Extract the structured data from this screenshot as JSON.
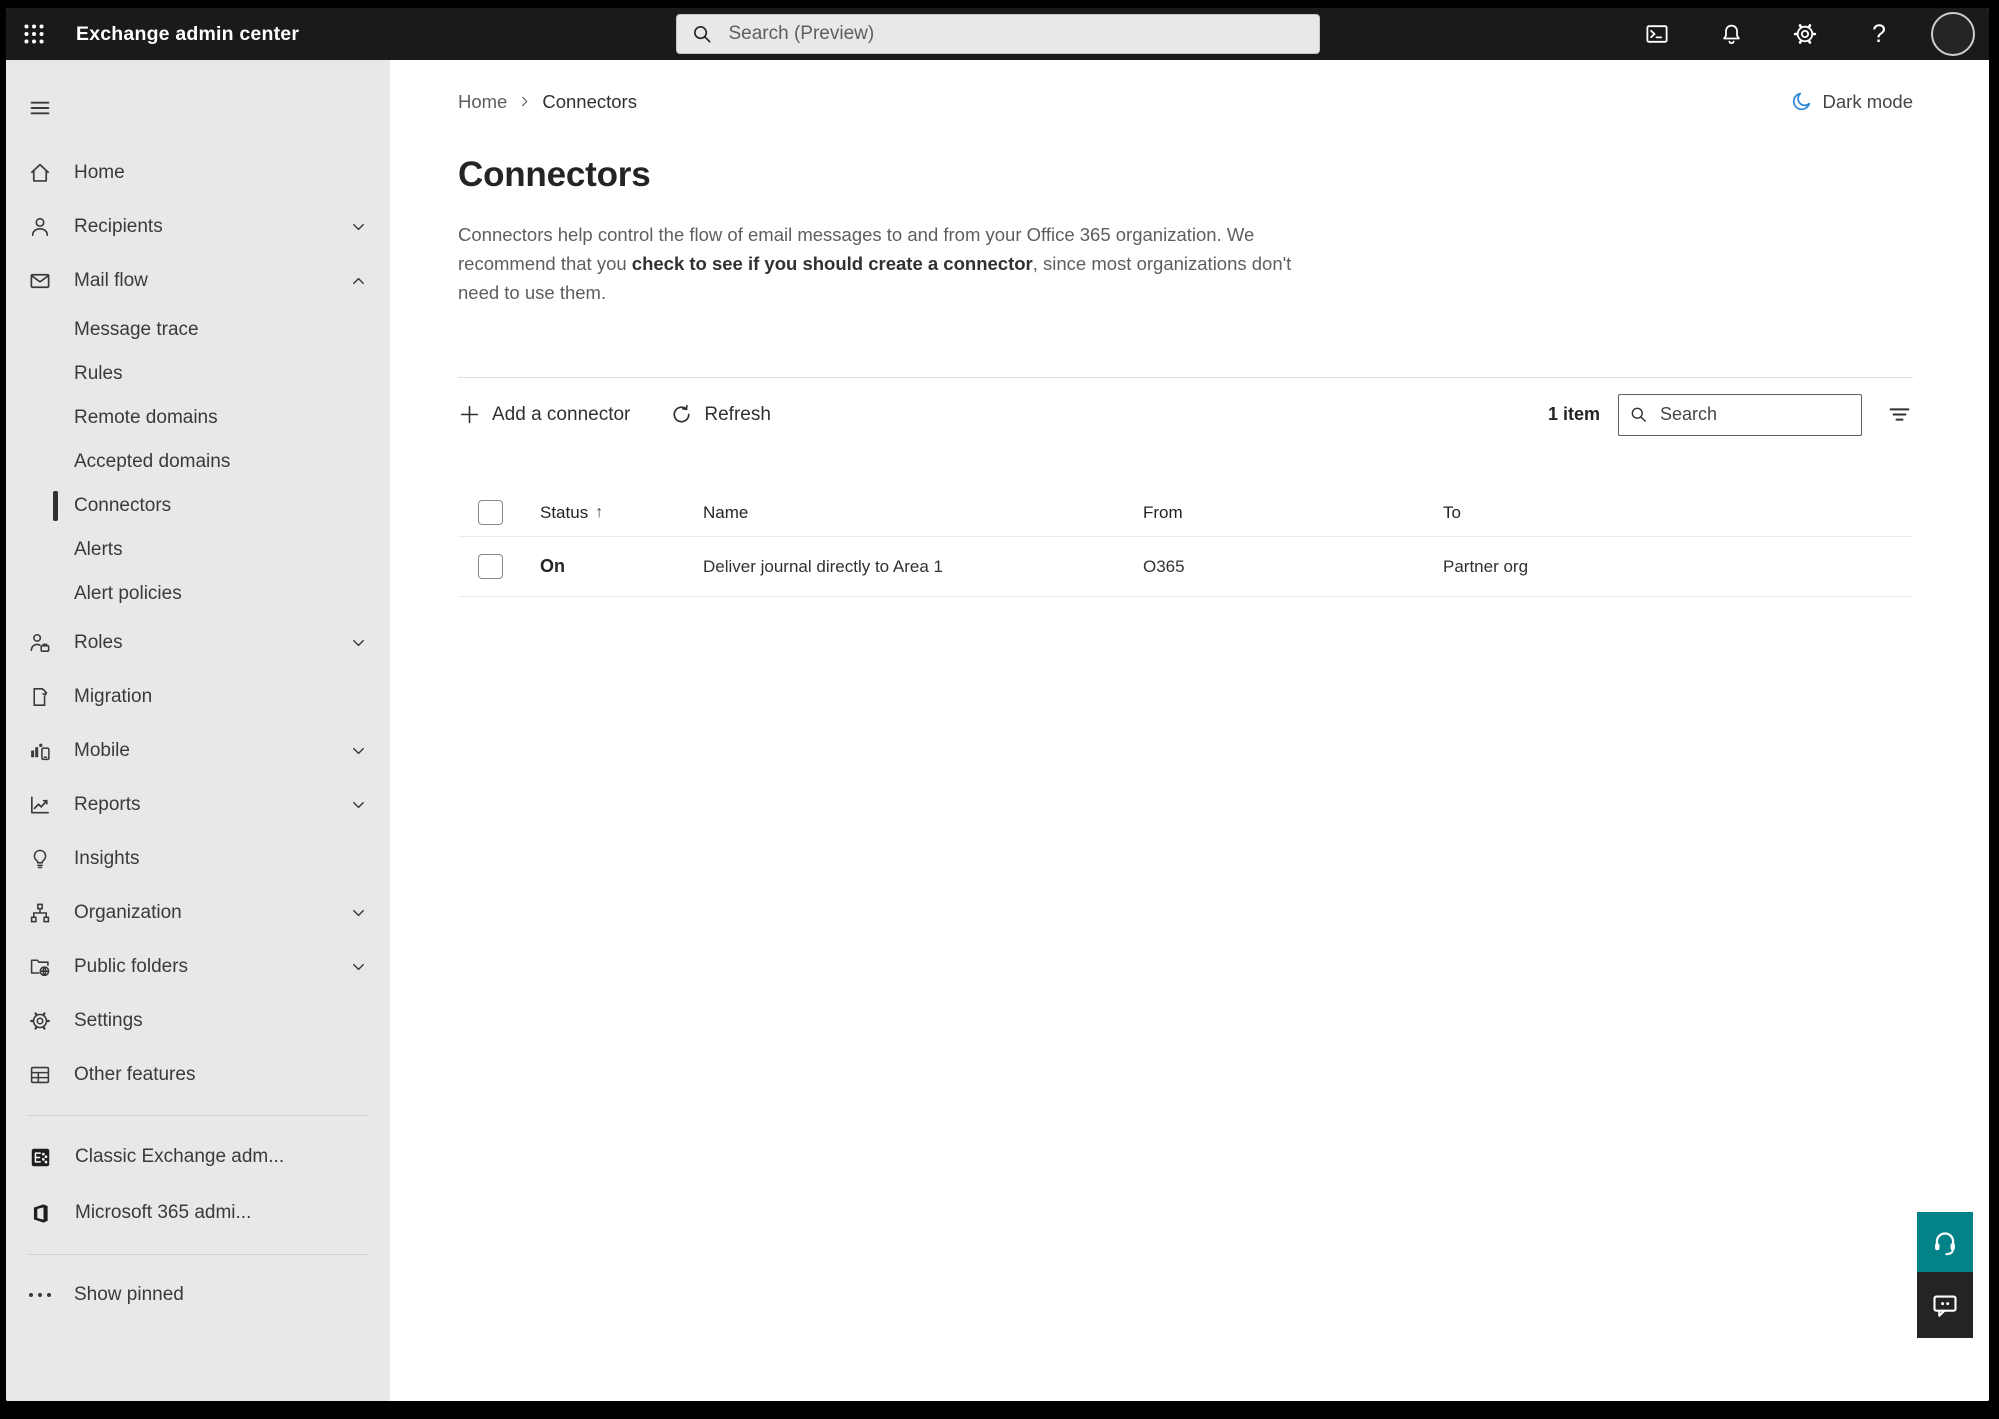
{
  "topbar": {
    "app_title": "Exchange admin center",
    "search_placeholder": "Search (Preview)",
    "icons": [
      "app-launcher",
      "powershell-terminal",
      "notifications-bell",
      "settings-gear",
      "help",
      "account-avatar"
    ]
  },
  "sidebar": {
    "items": [
      {
        "label": "Home",
        "icon": "home"
      },
      {
        "label": "Recipients",
        "icon": "person",
        "chevron": "down"
      },
      {
        "label": "Mail flow",
        "icon": "mail",
        "chevron": "up",
        "expanded": true
      },
      {
        "label": "Message trace",
        "type": "sub"
      },
      {
        "label": "Rules",
        "type": "sub"
      },
      {
        "label": "Remote domains",
        "type": "sub"
      },
      {
        "label": "Accepted domains",
        "type": "sub"
      },
      {
        "label": "Connectors",
        "type": "sub",
        "selected": true
      },
      {
        "label": "Alerts",
        "type": "sub"
      },
      {
        "label": "Alert policies",
        "type": "sub"
      },
      {
        "label": "Roles",
        "icon": "person-briefcase",
        "chevron": "down"
      },
      {
        "label": "Migration",
        "icon": "document-sync"
      },
      {
        "label": "Mobile",
        "icon": "chart-phone",
        "chevron": "down"
      },
      {
        "label": "Reports",
        "icon": "line-chart",
        "chevron": "down"
      },
      {
        "label": "Insights",
        "icon": "lightbulb"
      },
      {
        "label": "Organization",
        "icon": "org-chart",
        "chevron": "down"
      },
      {
        "label": "Public folders",
        "icon": "folder-globe",
        "chevron": "down"
      },
      {
        "label": "Settings",
        "icon": "gear"
      },
      {
        "label": "Other features",
        "icon": "table"
      },
      {
        "label": "Classic Exchange adm...",
        "icon": "exchange-logo",
        "type": "footer"
      },
      {
        "label": "Microsoft 365 admi...",
        "icon": "microsoft-365-logo",
        "type": "footer"
      },
      {
        "label": "Show pinned",
        "icon": "ellipsis"
      }
    ]
  },
  "main": {
    "breadcrumb": {
      "items": [
        "Home",
        "Connectors"
      ]
    },
    "dark_mode_label": "Dark mode",
    "title": "Connectors",
    "description": {
      "part1": "Connectors help control the flow of email messages to and from your Office 365 organization. We recommend that you ",
      "link_text": "check to see if you should create a connector",
      "part3": ", since most organizations don't need to use them."
    },
    "toolbar": {
      "add_label": "Add a connector",
      "refresh_label": "Refresh",
      "item_count": "1 item",
      "search_placeholder": "Search"
    },
    "table": {
      "headers": [
        "Status",
        "Name",
        "From",
        "To"
      ],
      "sort_column": "Status",
      "sort_direction": "ascending",
      "sort_indicator": "↑",
      "rows": [
        {
          "status": "On",
          "name": "Deliver journal directly to Area 1",
          "from": "O365",
          "to": "Partner org"
        }
      ]
    }
  },
  "helper_buttons": [
    {
      "icon": "headset-support"
    },
    {
      "icon": "feedback-chat"
    }
  ],
  "colors": {
    "topbar_bg": "#1b1a19",
    "sidebar_bg": "#e8e8e8",
    "selected_indicator": "#323130",
    "accent_blue": "#2b88d8",
    "support_teal": "#038387",
    "feedback_dark": "#252423"
  }
}
